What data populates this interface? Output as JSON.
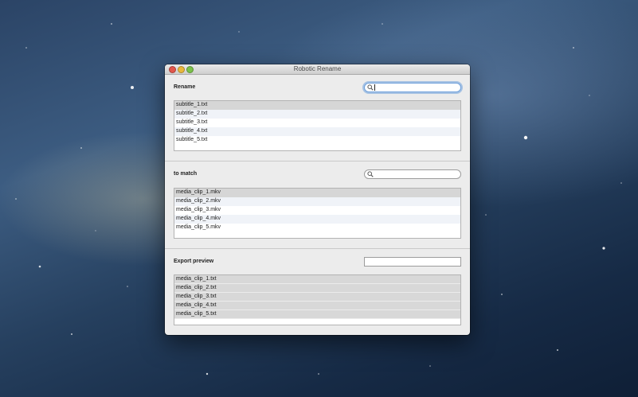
{
  "window": {
    "title": "Robotic Rename"
  },
  "sections": {
    "rename": {
      "label": "Rename",
      "items": [
        "subtitle_1.txt",
        "subtitle_2.txt",
        "subtitle_3.txt",
        "subtitle_4.txt",
        "subtitle_5.txt"
      ]
    },
    "match": {
      "label": "to match",
      "items": [
        "media_clip_1.mkv",
        "media_clip_2.mkv",
        "media_clip_3.mkv",
        "media_clip_4.mkv",
        "media_clip_5.mkv"
      ]
    },
    "export": {
      "label": "Export preview",
      "items": [
        "media_clip_1.txt",
        "media_clip_2.txt",
        "media_clip_3.txt",
        "media_clip_4.txt",
        "media_clip_5.txt"
      ]
    }
  },
  "icons": {
    "search": "magnifier-icon"
  },
  "colors": {
    "close": "#e2574c",
    "minimize": "#e9b83b",
    "zoom": "#7bc24a",
    "focus_ring": "#6fa0db"
  }
}
